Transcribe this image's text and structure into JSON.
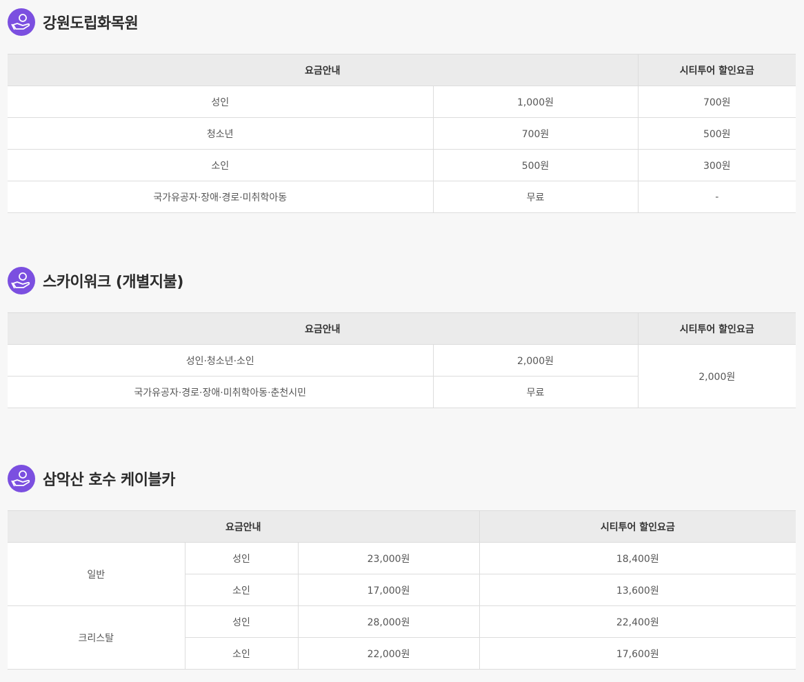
{
  "sections": [
    {
      "title": "강원도립화목원",
      "header": {
        "fare": "요금안내",
        "citytour": "시티투어 할인요금"
      },
      "rows": [
        {
          "label": "성인",
          "fare": "1,000원",
          "citytour": "700원"
        },
        {
          "label": "청소년",
          "fare": "700원",
          "citytour": "500원"
        },
        {
          "label": "소인",
          "fare": "500원",
          "citytour": "300원"
        },
        {
          "label": "국가유공자·장애·경로·미취학아동",
          "fare": "무료",
          "citytour": "-"
        }
      ]
    },
    {
      "title": "스카이워크 (개별지불)",
      "header": {
        "fare": "요금안내",
        "citytour": "시티투어 할인요금"
      },
      "rows": [
        {
          "label": "성인·청소년·소인",
          "fare": "2,000원"
        },
        {
          "label": "국가유공자·경로·장애·미취학아동·춘천시민",
          "fare": "무료"
        }
      ],
      "citytour_merged": "2,000원"
    },
    {
      "title": "삼악산 호수 케이블카",
      "header": {
        "fare": "요금안내",
        "citytour": "시티투어 할인요금"
      },
      "groups": [
        {
          "name": "일반",
          "rows": [
            {
              "label": "성인",
              "fare": "23,000원",
              "citytour": "18,400원"
            },
            {
              "label": "소인",
              "fare": "17,000원",
              "citytour": "13,600원"
            }
          ]
        },
        {
          "name": "크리스탈",
          "rows": [
            {
              "label": "성인",
              "fare": "28,000원",
              "citytour": "22,400원"
            },
            {
              "label": "소인",
              "fare": "22,000원",
              "citytour": "17,600원"
            }
          ]
        }
      ]
    }
  ],
  "accent_color": "#7b4fe0"
}
